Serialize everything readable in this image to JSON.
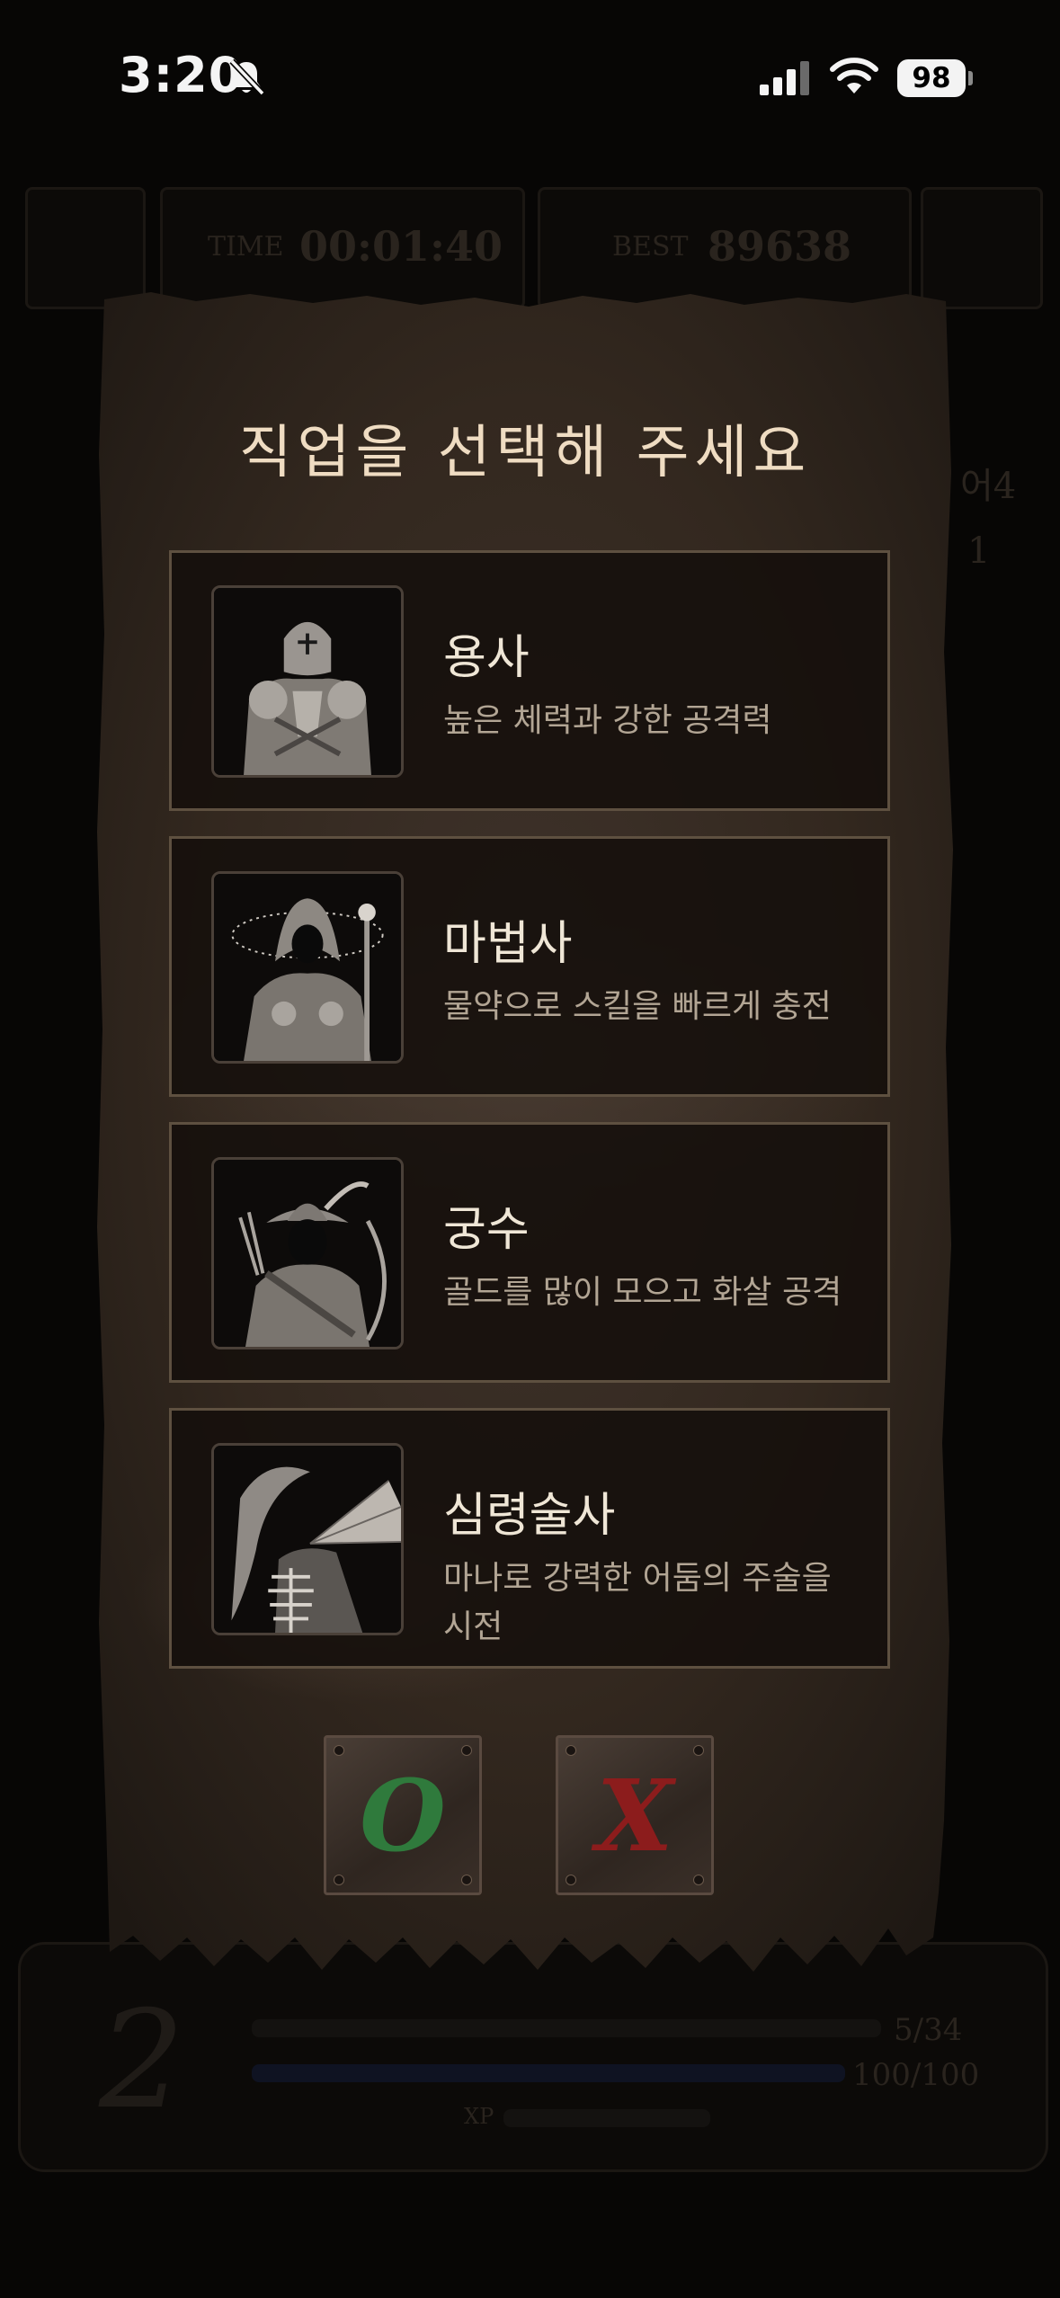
{
  "status_bar": {
    "time": "3:20",
    "battery": "98"
  },
  "background": {
    "time_label": "TIME",
    "time_value": "00:01:40",
    "best_label": "BEST",
    "best_value": "89638",
    "side_label_1": "어4",
    "side_label_2": "1",
    "level": "2",
    "hp": "5/34",
    "mp": "100/100",
    "xp_label": "XP"
  },
  "dialog": {
    "title": "직업을 선택해 주세요",
    "classes": [
      {
        "name": "용사",
        "description": "높은 체력과 강한 공격력",
        "icon": "knight-portrait"
      },
      {
        "name": "마법사",
        "description": "물약으로 스킬을 빠르게 충전",
        "icon": "mage-portrait"
      },
      {
        "name": "궁수",
        "description": "골드를 많이 모으고 화살 공격",
        "icon": "archer-portrait"
      },
      {
        "name": "심령술사",
        "description": "마나로 강력한 어둠의 주술을 시전",
        "icon": "necromancer-portrait"
      }
    ],
    "confirm_glyph": "O",
    "cancel_glyph": "X",
    "colors": {
      "confirm": "#2f7a3c",
      "cancel": "#8c1c1c",
      "parchment": "#3a2e26"
    }
  }
}
